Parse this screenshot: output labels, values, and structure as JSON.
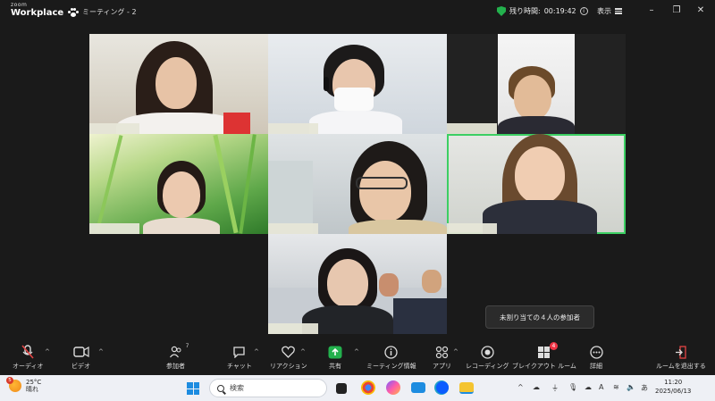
{
  "app": {
    "logo_top": "zoom",
    "logo_bottom": "Workplace",
    "meeting_title": "ミーティング - 2",
    "remaining_label": "残り時間:",
    "remaining_time": "00:19:42",
    "view_label": "表示"
  },
  "colors": {
    "accent_green": "#3ccf63",
    "shield_green": "#23b14d",
    "share_green": "#23b14d",
    "badge_red": "#e34444"
  },
  "tooltip": {
    "text": "未割り当ての４人の参加者"
  },
  "toolbar": {
    "audio": "オーディオ",
    "video": "ビデオ",
    "participants": "参加者",
    "participants_count": "7",
    "chat": "チャット",
    "reactions": "リアクション",
    "share": "共有",
    "meeting_info": "ミーティング情報",
    "apps": "アプリ",
    "record": "レコーディング",
    "breakout": "ブレイクアウト ルーム",
    "breakout_badge": "4",
    "more": "詳細",
    "leave": "ルームを退出する"
  },
  "taskbar": {
    "weather_badge": "5",
    "temperature": "25°C",
    "weather": "晴れ",
    "search_placeholder": "検索",
    "time": "11:20",
    "date": "2025/06/13",
    "tray_letter": "A",
    "tray_lang": "あ"
  }
}
